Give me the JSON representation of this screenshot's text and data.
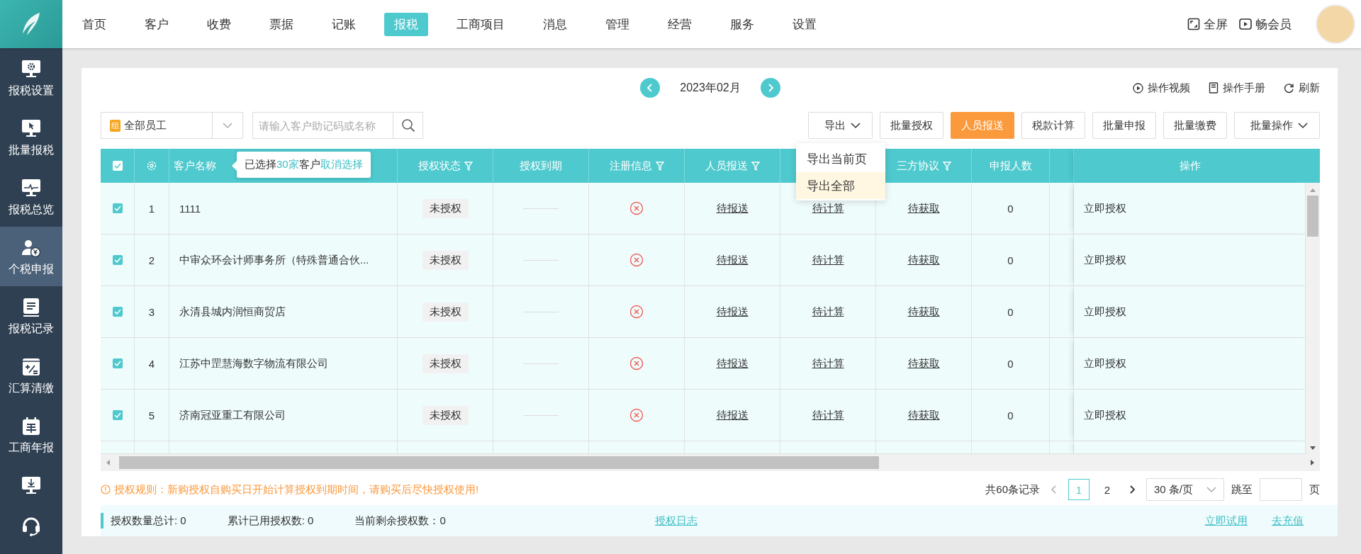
{
  "top_nav": {
    "items": [
      {
        "label": "首页",
        "selected": false
      },
      {
        "label": "客户",
        "selected": false
      },
      {
        "label": "收费",
        "selected": false
      },
      {
        "label": "票据",
        "selected": false
      },
      {
        "label": "记账",
        "selected": false
      },
      {
        "label": "报税",
        "selected": true
      },
      {
        "label": "工商项目",
        "selected": false
      },
      {
        "label": "消息",
        "selected": false
      },
      {
        "label": "管理",
        "selected": false
      },
      {
        "label": "经营",
        "selected": false
      },
      {
        "label": "服务",
        "selected": false
      },
      {
        "label": "设置",
        "selected": false
      }
    ],
    "fullscreen": "全屏",
    "membership": "畅会员"
  },
  "sidebar": {
    "items": [
      {
        "label": "报税设置",
        "selected": false
      },
      {
        "label": "批量报税",
        "selected": false
      },
      {
        "label": "报税总览",
        "selected": false
      },
      {
        "label": "个税申报",
        "selected": true
      },
      {
        "label": "报税记录",
        "selected": false
      },
      {
        "label": "汇算清缴",
        "selected": false
      },
      {
        "label": "工商年报",
        "selected": false
      }
    ]
  },
  "period": "2023年02月",
  "help_links": [
    "操作视频",
    "操作手册",
    "刷新"
  ],
  "staff_filter": {
    "badge": "组",
    "value": "全部员工"
  },
  "search": {
    "placeholder": "请输入客户助记码或名称"
  },
  "toolbar_buttons": [
    {
      "label": "导出",
      "kind": "dropdown"
    },
    {
      "label": "批量授权",
      "kind": "plain"
    },
    {
      "label": "人员报送",
      "kind": "highlight"
    },
    {
      "label": "税款计算",
      "kind": "plain"
    },
    {
      "label": "批量申报",
      "kind": "plain"
    },
    {
      "label": "批量缴费",
      "kind": "plain"
    },
    {
      "label": "批量操作",
      "kind": "dropdown"
    }
  ],
  "export_menu": [
    {
      "label": "导出当前页",
      "selected": false
    },
    {
      "label": "导出全部",
      "selected": true
    }
  ],
  "table": {
    "select_all_checked": true,
    "selection_tip": {
      "prefix": "已选择",
      "count": "30家",
      "middle": "客户",
      "action": "取消选择"
    },
    "columns": [
      {
        "label": "客户名称",
        "filterable": false
      },
      {
        "label": "授权状态",
        "filterable": true
      },
      {
        "label": "授权到期",
        "filterable": false
      },
      {
        "label": "注册信息",
        "filterable": true
      },
      {
        "label": "人员报送",
        "filterable": true
      },
      {
        "label": "三方协议",
        "filterable": true
      },
      {
        "label": "申报人数",
        "filterable": false
      },
      {
        "label": "操作",
        "filterable": false
      }
    ],
    "rows": [
      {
        "checked": true,
        "index": "1",
        "name": "1111",
        "auth_status": "未授权",
        "registration_ok": false,
        "staff_report": "待报送",
        "tax_calc": "待计算",
        "agreement": "待获取",
        "declared_count": "0",
        "action": "立即授权"
      },
      {
        "checked": true,
        "index": "2",
        "name": "中审众环会计师事务所（特殊普通合伙...",
        "auth_status": "未授权",
        "registration_ok": false,
        "staff_report": "待报送",
        "tax_calc": "待计算",
        "agreement": "待获取",
        "declared_count": "0",
        "action": "立即授权"
      },
      {
        "checked": true,
        "index": "3",
        "name": "永清县城内润恒商贸店",
        "auth_status": "未授权",
        "registration_ok": false,
        "staff_report": "待报送",
        "tax_calc": "待计算",
        "agreement": "待获取",
        "declared_count": "0",
        "action": "立即授权"
      },
      {
        "checked": true,
        "index": "4",
        "name": "江苏中罡慧海数字物流有限公司",
        "auth_status": "未授权",
        "registration_ok": false,
        "staff_report": "待报送",
        "tax_calc": "待计算",
        "agreement": "待获取",
        "declared_count": "0",
        "action": "立即授权"
      },
      {
        "checked": true,
        "index": "5",
        "name": "济南冠亚重工有限公司",
        "auth_status": "未授权",
        "registration_ok": false,
        "staff_report": "待报送",
        "tax_calc": "待计算",
        "agreement": "待获取",
        "declared_count": "0",
        "action": "立即授权"
      }
    ]
  },
  "rule_notice": "授权规则：新购授权自购买日开始计算授权到期时间，请购买后尽快授权使用!",
  "pagination": {
    "total": "共60条记录",
    "pages": [
      {
        "label": "1",
        "selected": true
      },
      {
        "label": "2",
        "selected": false
      }
    ],
    "page_size": "30 条/页",
    "jump_label": "跳至",
    "page_unit": "页"
  },
  "summary": {
    "stats": [
      "授权数量总计: 0",
      "累计已用授权数: 0",
      "当前剩余授权数：0"
    ],
    "log_link": "授权日志",
    "links": [
      "立即试用",
      "去充值"
    ]
  }
}
